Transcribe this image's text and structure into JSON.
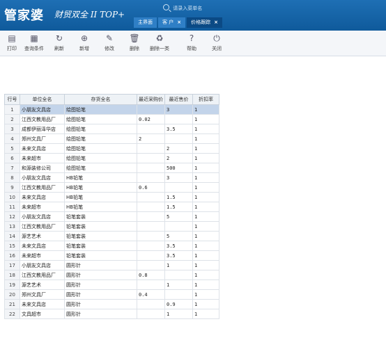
{
  "app": {
    "logo_cn": "管家婆",
    "logo_sub": "财贸双全 II TOP+"
  },
  "search": {
    "placeholder": "请录入菜单名"
  },
  "tabs": [
    {
      "label": "主界面",
      "closable": false,
      "active": false
    },
    {
      "label": "客 户",
      "closable": true,
      "active": false
    },
    {
      "label": "价格跟踪",
      "closable": true,
      "active": true
    }
  ],
  "toolbar": [
    {
      "label": "打印",
      "icon": "printer-icon",
      "glyph": "▤"
    },
    {
      "label": "查询条件",
      "icon": "query-icon",
      "glyph": "▦"
    },
    {
      "label": "刷新",
      "icon": "refresh-icon",
      "glyph": "↻"
    },
    {
      "label": "新增",
      "icon": "add-icon",
      "glyph": "⊕"
    },
    {
      "label": "修改",
      "icon": "edit-icon",
      "glyph": "✎"
    },
    {
      "label": "删除",
      "icon": "trash-icon",
      "glyph": "🗑"
    },
    {
      "label": "删除一类",
      "icon": "delete-category-icon",
      "glyph": "♻"
    },
    {
      "label": "帮助",
      "icon": "help-icon",
      "glyph": "?"
    },
    {
      "label": "关闭",
      "icon": "power-icon",
      "glyph": "⏻"
    }
  ],
  "table": {
    "columns": [
      "行号",
      "单位全名",
      "存货全名",
      "最近采购价",
      "最近售价",
      "折扣率"
    ],
    "selected_row": 1,
    "rows": [
      [
        "1",
        "小朋友文具店",
        "绘图铅笔",
        "",
        "3",
        "1"
      ],
      [
        "2",
        "江西文教用品厂",
        "绘图铅笔",
        "0.02",
        "",
        "1"
      ],
      [
        "3",
        "成都伊丽泽华店",
        "绘图铅笔",
        "",
        "3.5",
        "1"
      ],
      [
        "4",
        "郑州文具厂",
        "绘图铅笔",
        "2",
        "",
        "1"
      ],
      [
        "5",
        "未来文具店",
        "绘图铅笔",
        "",
        "2",
        "1"
      ],
      [
        "6",
        "未来超市",
        "绘图铅笔",
        "",
        "2",
        "1"
      ],
      [
        "7",
        "和源装修公司",
        "绘图铅笔",
        "",
        "500",
        "1"
      ],
      [
        "8",
        "小朋友文具店",
        "HB铅笔",
        "",
        "3",
        "1"
      ],
      [
        "9",
        "江西文教用品厂",
        "HB铅笔",
        "0.6",
        "",
        "1"
      ],
      [
        "10",
        "未来文具店",
        "HB铅笔",
        "",
        "1.5",
        "1"
      ],
      [
        "11",
        "未来超市",
        "HB铅笔",
        "",
        "1.5",
        "1"
      ],
      [
        "12",
        "小朋友文具店",
        "铅笔套装",
        "",
        "5",
        "1"
      ],
      [
        "13",
        "江西文教用品厂",
        "铅笔套装",
        "",
        "",
        "1"
      ],
      [
        "14",
        "源艺艺术",
        "铅笔套装",
        "",
        "5",
        "1"
      ],
      [
        "15",
        "未来文具店",
        "铅笔套装",
        "",
        "3.5",
        "1"
      ],
      [
        "16",
        "未来超市",
        "铅笔套装",
        "",
        "3.5",
        "1"
      ],
      [
        "17",
        "小朋友文具店",
        "圆形针",
        "",
        "1",
        "1"
      ],
      [
        "18",
        "江西文教用品厂",
        "圆形针",
        "0.8",
        "",
        "1"
      ],
      [
        "19",
        "源艺艺术",
        "圆形针",
        "",
        "1",
        "1"
      ],
      [
        "20",
        "郑州文具厂",
        "圆形针",
        "0.4",
        "",
        "1"
      ],
      [
        "21",
        "未来文具店",
        "圆形针",
        "",
        "0.9",
        "1"
      ],
      [
        "22",
        "文具超市",
        "圆形针",
        "",
        "1",
        "1"
      ]
    ]
  }
}
